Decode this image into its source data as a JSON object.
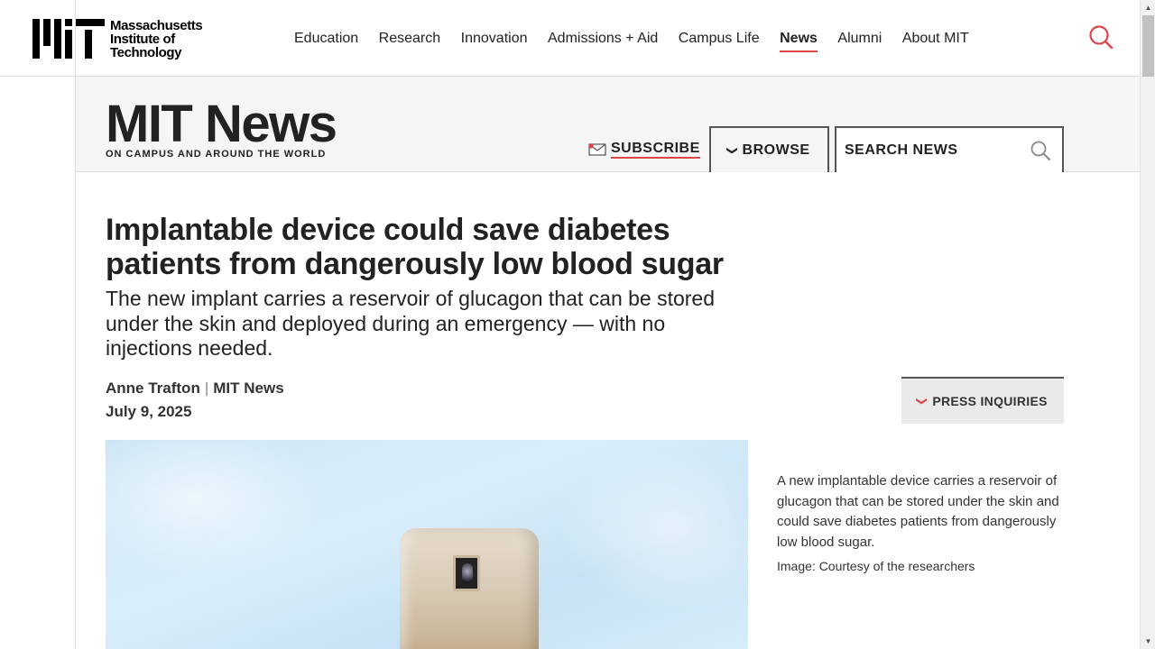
{
  "header": {
    "logo": {
      "line1": "Massachusetts",
      "line2": "Institute of",
      "line3": "Technology"
    },
    "nav": [
      {
        "label": "Education"
      },
      {
        "label": "Research"
      },
      {
        "label": "Innovation"
      },
      {
        "label": "Admissions + Aid"
      },
      {
        "label": "Campus Life"
      },
      {
        "label": "News",
        "active": true
      },
      {
        "label": "Alumni"
      },
      {
        "label": "About MIT"
      }
    ],
    "search_icon": "search-icon"
  },
  "news_band": {
    "title": "MIT News",
    "tagline": "ON CAMPUS AND AROUND THE WORLD",
    "subscribe_label": "SUBSCRIBE",
    "browse_label": "BROWSE",
    "search_placeholder": "SEARCH NEWS"
  },
  "article": {
    "headline": "Implantable device could save diabetes patients from dangerously low blood sugar",
    "dek": "The new implant carries a reservoir of glucagon that can be stored under the skin and deployed during an emergency — with no injections needed.",
    "author": "Anne Trafton",
    "source": "MIT News",
    "date": "July 9, 2025",
    "press_label": "PRESS INQUIRIES",
    "caption": "A new implantable device carries a reservoir of glucagon that can be stored under the skin and could save diabetes patients from dangerously low blood sugar.",
    "credit": "Image: Courtesy of the researchers"
  },
  "colors": {
    "accent": "#e0454a",
    "band_bg": "#f5f5f5",
    "text": "#222222"
  }
}
